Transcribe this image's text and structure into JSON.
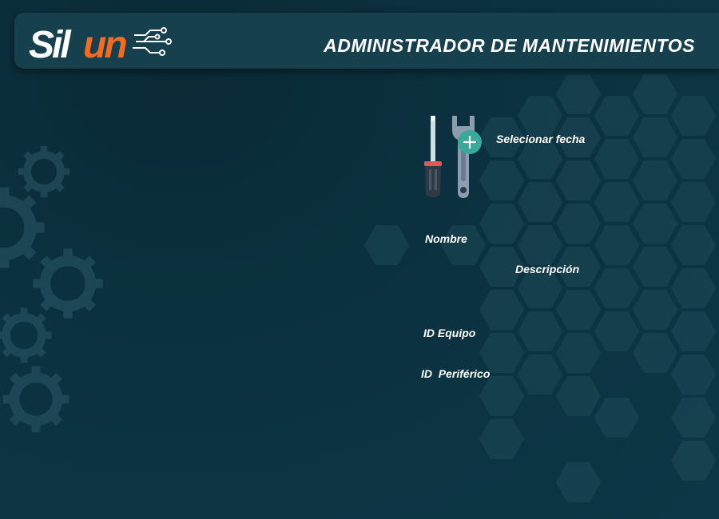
{
  "header": {
    "title": "ADMINISTRADOR DE MANTENIMIENTOS",
    "logo_text": "SilUn",
    "logo_colors": {
      "primary": "#ffffff",
      "accent": "#f36a21"
    }
  },
  "icons": {
    "tools": "screwdriver-wrench-icon",
    "add": "plus-circle-icon"
  },
  "form": {
    "select_date_label": "Selecionar fecha",
    "name_label": "Nombre",
    "description_label": "Descripción",
    "equipment_id_label": "ID Equipo",
    "peripheral_id_label": "ID  Periférico"
  },
  "colors": {
    "background": "#0b3140",
    "header_bar": "#17404f",
    "add_button": "#3aa99b",
    "screwdriver_handle": "#e05a4e"
  }
}
